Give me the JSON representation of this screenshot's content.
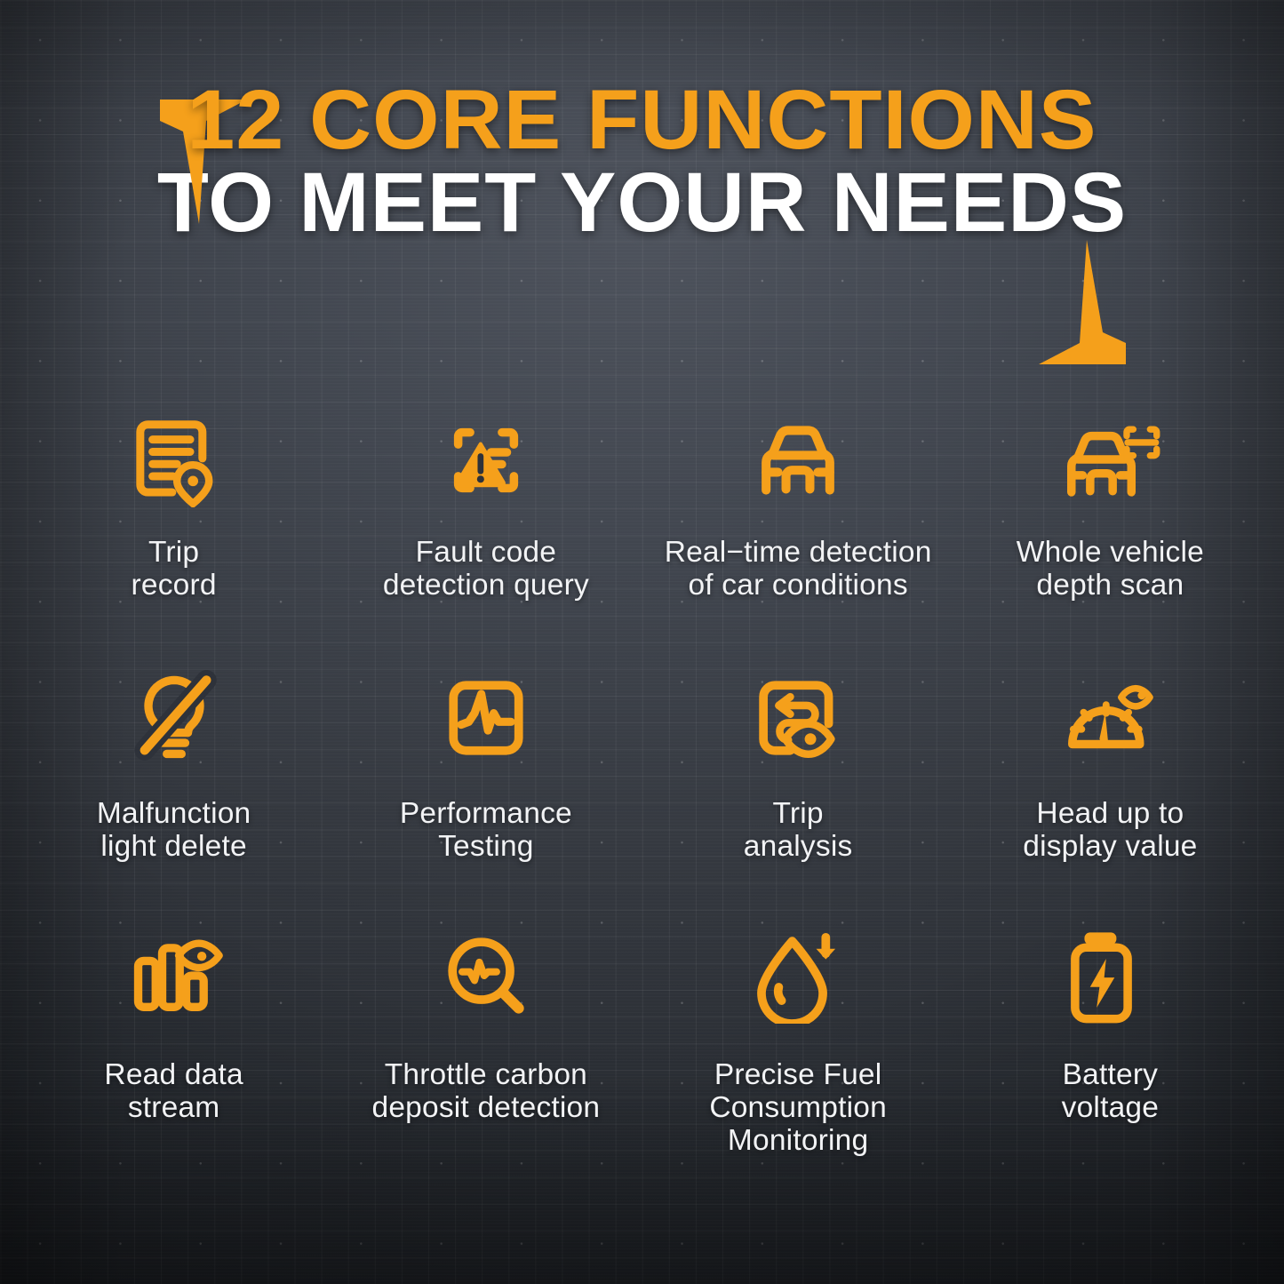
{
  "colors": {
    "accent": "#F5A01B",
    "text_primary": "#FFFFFF",
    "background_dark": "#2B2F36"
  },
  "header": {
    "title_top": "12 CORE FUNCTIONS",
    "title_bottom": "TO MEET YOUR NEEDS",
    "bracket_top_left": "corner-bracket-top-left",
    "bracket_bottom_right": "corner-bracket-bottom-right"
  },
  "features": [
    {
      "icon": "trip-record-icon",
      "label": "Trip\nrecord"
    },
    {
      "icon": "fault-code-scan-icon",
      "label": "Fault code\ndetection query"
    },
    {
      "icon": "car-front-icon",
      "label": "Real−time detection\nof car conditions"
    },
    {
      "icon": "car-scan-icon",
      "label": "Whole vehicle\ndepth scan"
    },
    {
      "icon": "bulb-slash-icon",
      "label": "Malfunction\nlight delete"
    },
    {
      "icon": "waveform-monitor-icon",
      "label": "Performance\nTesting"
    },
    {
      "icon": "trip-analysis-eye-icon",
      "label": "Trip\nanalysis"
    },
    {
      "icon": "speedometer-eye-icon",
      "label": "Head up to\ndisplay value"
    },
    {
      "icon": "bar-chart-eye-icon",
      "label": "Read data\nstream"
    },
    {
      "icon": "magnifier-pulse-icon",
      "label": "Throttle carbon\ndeposit detection"
    },
    {
      "icon": "fuel-drop-arrow-icon",
      "label": "Precise Fuel\nConsumption Monitoring"
    },
    {
      "icon": "battery-bolt-icon",
      "label": "Battery\nvoltage"
    }
  ]
}
